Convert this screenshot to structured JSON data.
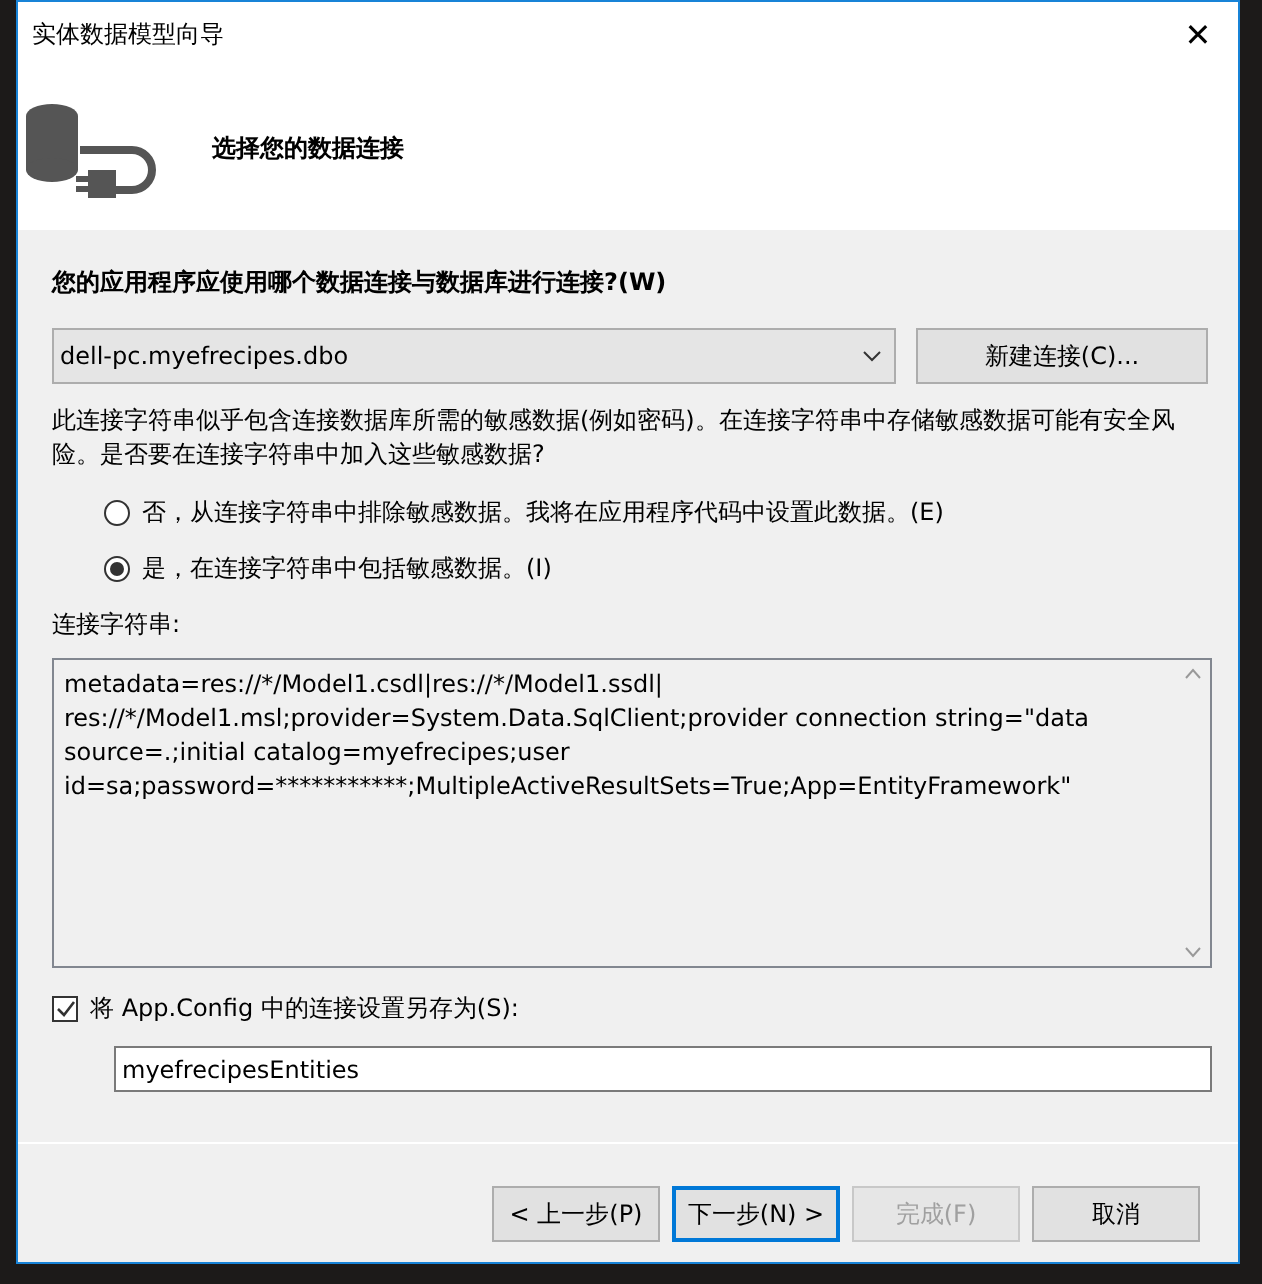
{
  "window": {
    "title": "实体数据模型向导",
    "close": "✕"
  },
  "header": {
    "title": "选择您的数据连接"
  },
  "question": "您的应用程序应使用哪个数据连接与数据库进行连接?(W)",
  "connection": {
    "value": "dell-pc.myefrecipes.dbo"
  },
  "new_connection_button": "新建连接(C)...",
  "warning": "此连接字符串似乎包含连接数据库所需的敏感数据(例如密码)。在连接字符串中存储敏感数据可能有安全风险。是否要在连接字符串中加入这些敏感数据?",
  "options": [
    {
      "label": "否，从连接字符串中排除敏感数据。我将在应用程序代码中设置此数据。(E)",
      "selected": false
    },
    {
      "label": "是，在连接字符串中包括敏感数据。(I)",
      "selected": true
    }
  ],
  "connection_string_label": "连接字符串:",
  "connection_string_lines": [
    "metadata=res://*/Model1.csdl|res://*/Model1.ssdl|",
    "res://*/Model1.msl;provider=System.Data.SqlClient;provider connection string=\"data",
    "source=.;initial catalog=myefrecipes;user",
    "id=sa;password=***********;MultipleActiveResultSets=True;App=EntityFramework\""
  ],
  "save_setting": {
    "label": "将 App.Config 中的连接设置另存为(S):",
    "checked": true,
    "value": "myefrecipesEntities"
  },
  "buttons": [
    {
      "label": "< 上一步(P)",
      "disabled": false,
      "default": false
    },
    {
      "label": "下一步(N) >",
      "disabled": false,
      "default": true
    },
    {
      "label": "完成(F)",
      "disabled": true,
      "default": false
    },
    {
      "label": "取消",
      "disabled": false,
      "default": false
    }
  ]
}
